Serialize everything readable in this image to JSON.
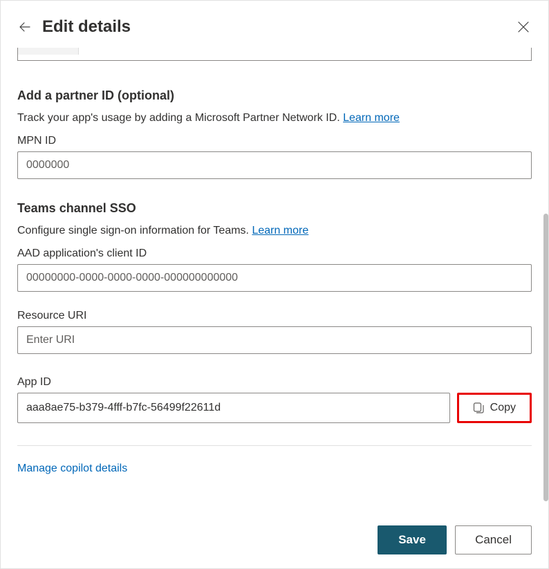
{
  "header": {
    "title": "Edit details"
  },
  "partner": {
    "title": "Add a partner ID (optional)",
    "desc": "Track your app's usage by adding a Microsoft Partner Network ID. ",
    "learn_more": "Learn more",
    "mpn_label": "MPN ID",
    "mpn_placeholder": "0000000",
    "mpn_value": ""
  },
  "sso": {
    "title": "Teams channel SSO",
    "desc": "Configure single sign-on information for Teams. ",
    "learn_more": "Learn more",
    "client_id_label": "AAD application's client ID",
    "client_id_placeholder": "00000000-0000-0000-0000-000000000000",
    "client_id_value": "",
    "resource_uri_label": "Resource URI",
    "resource_uri_placeholder": "Enter URI",
    "resource_uri_value": ""
  },
  "appid": {
    "label": "App ID",
    "value": "aaa8ae75-b379-4fff-b7fc-56499f22611d",
    "copy_label": "Copy"
  },
  "manage_link": "Manage copilot details",
  "footer": {
    "save": "Save",
    "cancel": "Cancel"
  }
}
